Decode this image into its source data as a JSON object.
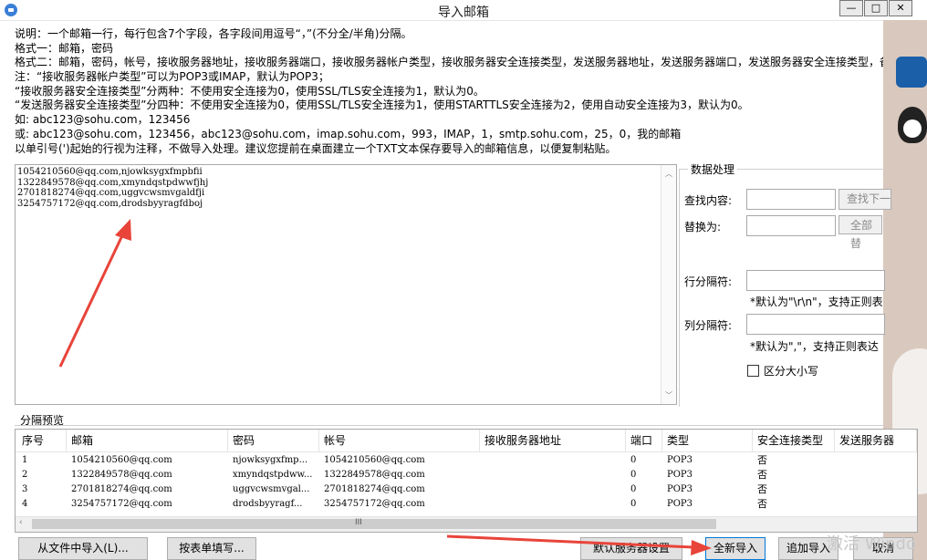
{
  "window": {
    "title": "导入邮箱",
    "minimize": "—",
    "maximize": "□",
    "close": "✕"
  },
  "instructions": [
    "说明：一个邮箱一行，每行包含7个字段，各字段间用逗号“，”(不分全/半角)分隔。",
    "格式一：邮箱，密码",
    "格式二：邮箱，密码，帐号，接收服务器地址，接收服务器端口，接收服务器帐户类型，接收服务器安全连接类型，发送服务器地址，发送服务器端口，发送服务器安全连接类型，备",
    "注：“接收服务器帐户类型”可以为POP3或IMAP，默认为POP3；",
    "      “接收服务器安全连接类型”分两种：不使用安全连接为0，使用SSL/TLS安全连接为1，默认为0。",
    "      “发送服务器安全连接类型”分四种：不使用安全连接为0，使用SSL/TLS安全连接为1，使用STARTTLS安全连接为2，使用自动安全连接为3，默认为0。",
    "如:   abc123@sohu.com，123456",
    "或:   abc123@sohu.com，123456，abc123@sohu.com，imap.sohu.com，993，IMAP，1，smtp.sohu.com，25，0，我的邮箱",
    "以单引号(')起始的行视为注释，不做导入处理。建议您提前在桌面建立一个TXT文本保存要导入的邮箱信息，以便复制粘贴。"
  ],
  "input_lines": [
    "1054210560@qq.com,njowksygxfmpbfii",
    "1322849578@qq.com,xmyndqstpdwwfjhj",
    "2701818274@qq.com,uggvcwsmvgaldfji",
    "3254757172@qq.com,drodsbyyragfdboj"
  ],
  "data_processing": {
    "title": "数据处理",
    "find_label": "查找内容:",
    "find_next": "查找下一",
    "replace_label": "替换为:",
    "replace_all": "全部替",
    "row_sep_label": "行分隔符:",
    "row_sep_hint": "*默认为\"\\r\\n\"，支持正则表",
    "col_sep_label": "列分隔符:",
    "col_sep_hint": "*默认为\",\"，支持正则表达",
    "case_label": "区分大小写"
  },
  "preview": {
    "label": "分隔预览",
    "columns": [
      "序号",
      "邮箱",
      "密码",
      "帐号",
      "接收服务器地址",
      "端口",
      "类型",
      "安全连接类型",
      "发送服务器"
    ],
    "rows": [
      [
        "1",
        "1054210560@qq.com",
        "njowksygxfmp...",
        "1054210560@qq.com",
        "",
        "0",
        "POP3",
        "否"
      ],
      [
        "2",
        "1322849578@qq.com",
        "xmyndqstpdww...",
        "1322849578@qq.com",
        "",
        "0",
        "POP3",
        "否"
      ],
      [
        "3",
        "2701818274@qq.com",
        "uggvcwsmvgal...",
        "2701818274@qq.com",
        "",
        "0",
        "POP3",
        "否"
      ],
      [
        "4",
        "3254757172@qq.com",
        "drodsbyyragf...",
        "3254757172@qq.com",
        "",
        "0",
        "POP3",
        "否"
      ]
    ],
    "scroll_grip": "III"
  },
  "buttons": {
    "import_file": "从文件中导入(L)...",
    "fill_form": "按表单填写...",
    "default_server": "默认服务器设置",
    "full_import": "全新导入",
    "append_import": "追加导入",
    "cancel": "取消"
  },
  "watermark": "激活 Windo",
  "colors": {
    "arrow": "#e8443a",
    "accent": "#3b7fd6"
  }
}
